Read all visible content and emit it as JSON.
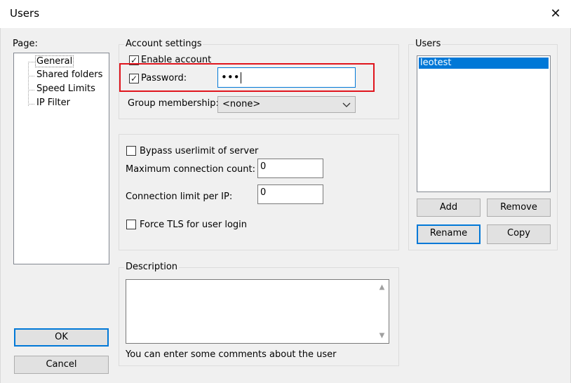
{
  "window": {
    "title": "Users",
    "close_glyph": "✕"
  },
  "page_panel": {
    "label": "Page:",
    "tree": [
      {
        "label": "General",
        "selected": true
      },
      {
        "label": "Shared folders",
        "selected": false
      },
      {
        "label": "Speed Limits",
        "selected": false
      },
      {
        "label": "IP Filter",
        "selected": false
      }
    ]
  },
  "account_settings": {
    "title": "Account settings",
    "enable_account_label": "Enable account",
    "enable_account_checked": true,
    "password_label": "Password:",
    "password_checked": true,
    "password_value": "•••",
    "group_membership_label": "Group membership:",
    "group_membership_value": "<none>"
  },
  "limits": {
    "bypass_label": "Bypass userlimit of server",
    "bypass_checked": false,
    "max_conn_label": "Maximum connection count:",
    "max_conn_value": "0",
    "conn_per_ip_label": "Connection limit per IP:",
    "conn_per_ip_value": "0",
    "force_tls_label": "Force TLS for user login",
    "force_tls_checked": false
  },
  "description": {
    "title": "Description",
    "value": "",
    "hint": "You can enter some comments about the user"
  },
  "users_panel": {
    "title": "Users",
    "items": [
      "leotest"
    ],
    "selected_index": 0,
    "add_label": "Add",
    "remove_label": "Remove",
    "rename_label": "Rename",
    "copy_label": "Copy"
  },
  "dialog_buttons": {
    "ok_label": "OK",
    "cancel_label": "Cancel"
  },
  "icons": {
    "check_glyph": "✓",
    "chevron_down": "⌄",
    "scroll_up": "▲",
    "scroll_down": "▼"
  },
  "colors": {
    "highlight_border": "#e0151d",
    "selection": "#0078d7",
    "dialog_bg": "#f0f0f0"
  }
}
